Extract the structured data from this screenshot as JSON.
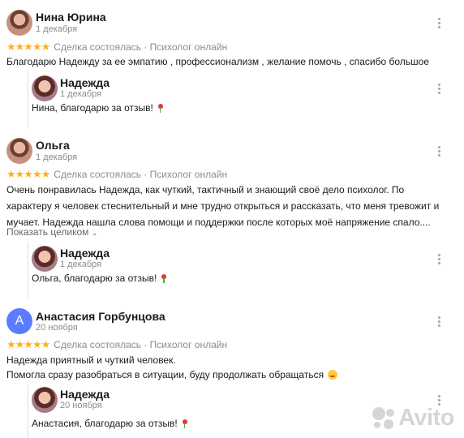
{
  "reviews": [
    {
      "avatar": "Нина Юрина photo",
      "name": "Нина Юрина",
      "date": "1 декабря",
      "rating_text": "Сделка состоялась · Психолог онлайн",
      "text": "Благодарю Надежду за ее эмпатию , профессионализм , желание помочь , спасибо большое",
      "reply": {
        "name": "Надежда",
        "date": "1 декабря",
        "text": "Нина, благодарю за отзыв!"
      }
    },
    {
      "avatar": "Ольга photo",
      "name": "Ольга",
      "date": "1 декабря",
      "rating_text": "Сделка состоялась · Психолог онлайн",
      "text": "Очень понравилась Надежда, как чуткий, тактичный и знающий своё дело психолог. По характеру я человек стеснительный и мне трудно открыться и рассказать, что меня тревожит и мучает. Надежда нашла слова помощи и поддержки после которых моё напряжение спало....",
      "show_more": "Показать целиком",
      "reply": {
        "name": "Надежда",
        "date": "1 декабря",
        "text": "Ольга, благодарю за отзыв!"
      }
    },
    {
      "avatar": "A",
      "name": "Анастасия Горбунцова",
      "date": "20 ноября",
      "rating_text": "Сделка состоялась · Психолог онлайн",
      "text_line1": "Надежда приятный и чуткий человек.",
      "text_line2": "Помогла сразу разобраться в ситуации, буду продолжать обращаться",
      "reply": {
        "name": "Надежда",
        "date": "20 ноября",
        "text": "Анастасия, благодарю за отзыв!"
      }
    }
  ],
  "stars": "★★★★★",
  "rating": 5,
  "icons": {
    "menu": "kebab-menu-icon",
    "show_more": "chevron-down-icon",
    "reply_reaction": "rose-emoji-icon",
    "review_reaction": "smiling-face-emoji-icon"
  },
  "colors": {
    "stars": "#ffb021",
    "avatar_letter_bg": "#5b7cff",
    "date": "#8c8c8c",
    "watermark": "#d2d2d2"
  },
  "watermark": "Avito"
}
